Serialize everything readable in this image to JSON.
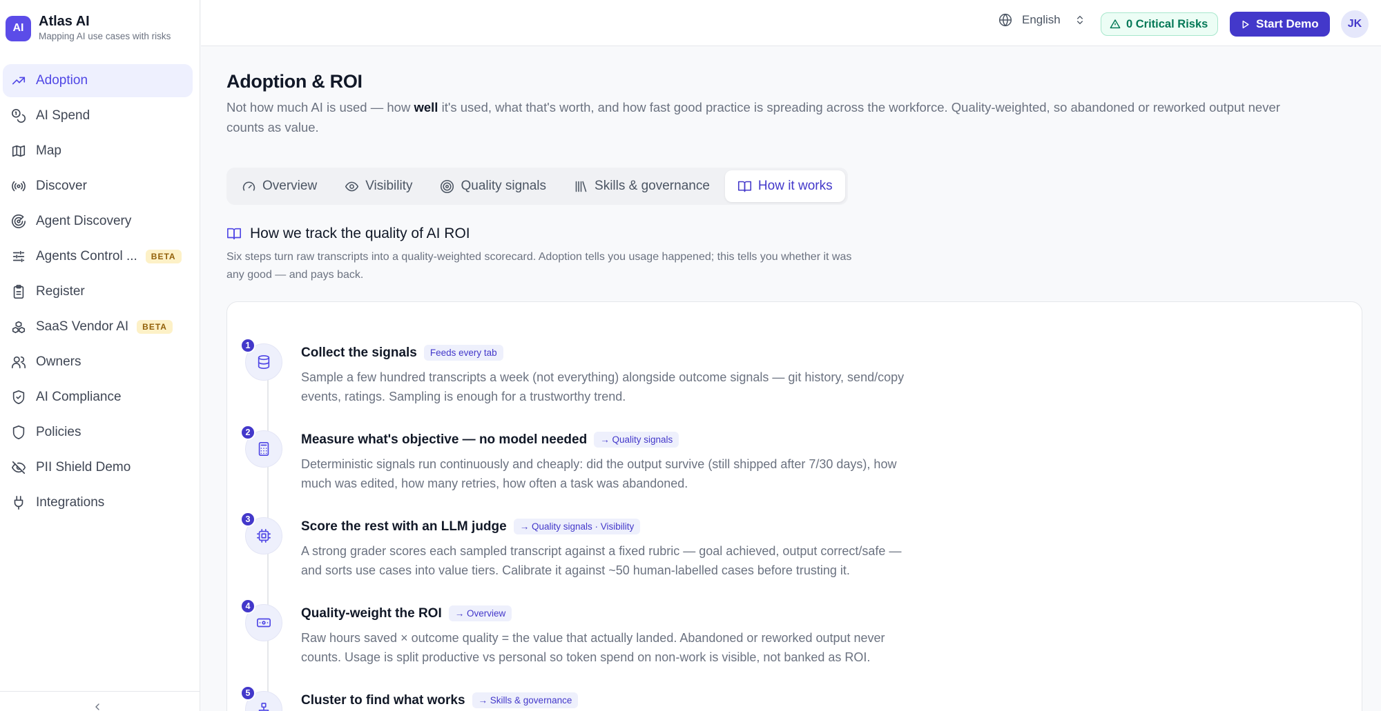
{
  "brand": {
    "logo": "AI",
    "title": "Atlas AI",
    "subtitle": "Mapping AI use cases with risks"
  },
  "nav": [
    {
      "label": "Adoption",
      "icon": "trending-up-icon",
      "active": true
    },
    {
      "label": "AI Spend",
      "icon": "coins-icon"
    },
    {
      "label": "Map",
      "icon": "map-icon"
    },
    {
      "label": "Discover",
      "icon": "radio-icon"
    },
    {
      "label": "Agent Discovery",
      "icon": "radar-icon"
    },
    {
      "label": "Agents Control ...",
      "icon": "sliders-icon",
      "badge": "BETA"
    },
    {
      "label": "Register",
      "icon": "clipboard-icon"
    },
    {
      "label": "SaaS Vendor AI",
      "icon": "boxes-icon",
      "badge": "BETA"
    },
    {
      "label": "Owners",
      "icon": "users-icon"
    },
    {
      "label": "AI Compliance",
      "icon": "shield-check-icon"
    },
    {
      "label": "Policies",
      "icon": "shield-icon"
    },
    {
      "label": "PII Shield Demo",
      "icon": "eye-off-icon"
    },
    {
      "label": "Integrations",
      "icon": "plug-icon"
    }
  ],
  "topbar": {
    "language": "English",
    "risks": "0 Critical Risks",
    "demo": "Start Demo",
    "avatar": "JK"
  },
  "page": {
    "title": "Adoption & ROI",
    "desc_pre": "Not how much AI is used — how ",
    "desc_bold": "well",
    "desc_post": " it's used, what that's worth, and how fast good practice is spreading across the workforce. Quality-weighted, so abandoned or reworked output never counts as value."
  },
  "tabs": [
    {
      "label": "Overview",
      "icon": "gauge-icon"
    },
    {
      "label": "Visibility",
      "icon": "eye-icon"
    },
    {
      "label": "Quality signals",
      "icon": "target-icon"
    },
    {
      "label": "Skills & governance",
      "icon": "library-icon"
    },
    {
      "label": "How it works",
      "icon": "book-open-icon",
      "active": true
    }
  ],
  "section": {
    "title": "How we track the quality of AI ROI",
    "desc": "Six steps turn raw transcripts into a quality-weighted scorecard. Adoption tells you usage happened; this tells you whether it was any good — and pays back."
  },
  "steps": [
    {
      "num": "1",
      "icon": "database-icon",
      "title": "Collect the signals",
      "tag": "Feeds every tab",
      "body": "Sample a few hundred transcripts a week (not everything) alongside outcome signals — git history, send/copy events, ratings. Sampling is enough for a trustworthy trend."
    },
    {
      "num": "2",
      "icon": "calculator-icon",
      "title": "Measure what's objective — no model needed",
      "tag": "→ Quality signals",
      "body": "Deterministic signals run continuously and cheaply: did the output survive (still shipped after 7/30 days), how much was edited, how many retries, how often a task was abandoned."
    },
    {
      "num": "3",
      "icon": "cpu-icon",
      "title": "Score the rest with an LLM judge",
      "tag": "→ Quality signals · Visibility",
      "body": "A strong grader scores each sampled transcript against a fixed rubric — goal achieved, output correct/safe — and sorts use cases into value tiers. Calibrate it against ~50 human-labelled cases before trusting it."
    },
    {
      "num": "4",
      "icon": "banknote-icon",
      "title": "Quality-weight the ROI",
      "tag": "→ Overview",
      "body": "Raw hours saved × outcome quality = the value that actually landed. Abandoned or reworked output never counts. Usage is split productive vs personal so token spend on non-work is visible, not banked as ROI."
    },
    {
      "num": "5",
      "icon": "network-icon",
      "title": "Cluster to find what works",
      "tag": "→ Skills & governance",
      "body": ""
    }
  ]
}
